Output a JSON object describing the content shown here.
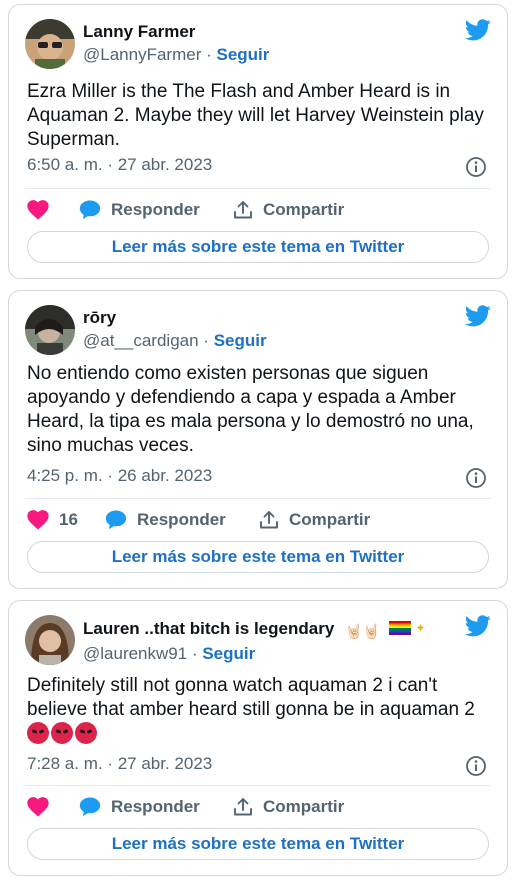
{
  "tweets": [
    {
      "name": "Lanny Farmer",
      "handle": "@LannyFarmer",
      "follow": "Seguir",
      "text": "Ezra Miller is the The Flash and Amber Heard is in Aquaman 2. Maybe they will let Harvey Weinstein play Superman.",
      "time": "6:50 a. m. · 27 abr. 2023",
      "likes": "",
      "reply": "Responder",
      "share": "Compartir",
      "read_more": "Leer más sobre este tema en Twitter"
    },
    {
      "name": "rōry",
      "handle": "@at__cardigan",
      "follow": "Seguir",
      "text": "No entiendo como existen personas que siguen apoyando y defendiendo a capa y espada a Amber Heard, la tipa es mala persona y lo demostró no una, sino muchas veces.",
      "time": "4:25 p. m. · 26 abr. 2023",
      "likes": "16",
      "reply": "Responder",
      "share": "Compartir",
      "read_more": "Leer más sobre este tema en Twitter"
    },
    {
      "name": "Lauren ..that bitch is legendary",
      "name_emoji": "🤘🏻🤘🏻",
      "handle": "@laurenkw91",
      "follow": "Seguir",
      "text": "Definitely still not gonna watch aquaman 2 i can't believe that amber heard still gonna be in aquaman 2",
      "time": "7:28 a. m. · 27 abr. 2023",
      "likes": "",
      "reply": "Responder",
      "share": "Compartir",
      "read_more": "Leer más sobre este tema en Twitter"
    }
  ],
  "colors": {
    "link": "#1d70c2",
    "like": "#f91880",
    "reply_icon": "#1d9bf0",
    "muted": "#536471",
    "border": "#cfd9de"
  },
  "icons": [
    "twitter-bird-icon",
    "info-icon",
    "heart-icon",
    "reply-bubble-icon",
    "share-icon",
    "angry-face-icon",
    "rainbow-flag-icon",
    "sparkles-icon"
  ]
}
